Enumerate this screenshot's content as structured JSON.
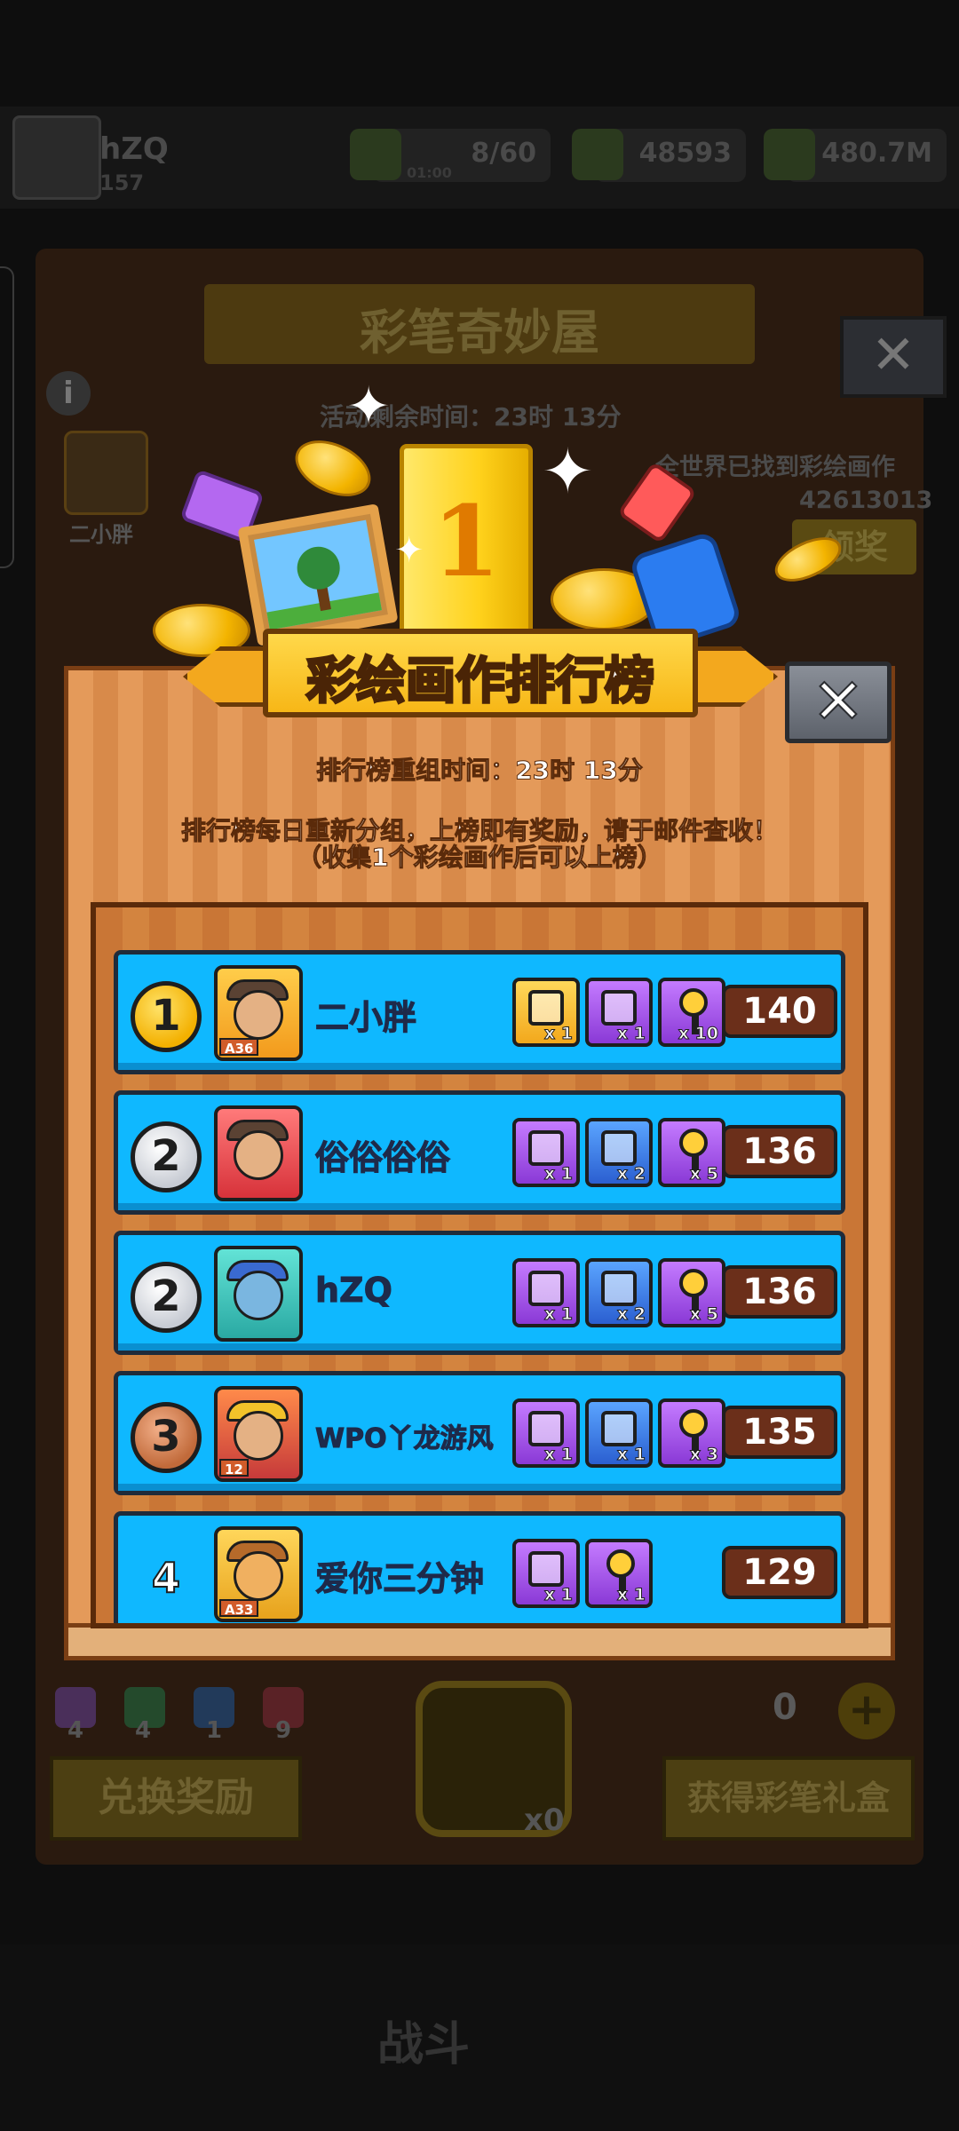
{
  "background": {
    "player_name": "hZQ",
    "player_level": "157",
    "resources": [
      {
        "value": "8/60",
        "sub": "01:00"
      },
      {
        "value": "48593"
      },
      {
        "value": "480.7M"
      }
    ],
    "shop_title": "彩笔奇妙屋",
    "event_time": "活动剩余时间：23时 13分",
    "leader_name": "二小胖",
    "world_text": "全世界已找到彩绘画作",
    "world_count": "42613013",
    "claim_label": "领奖",
    "pencil_counts": [
      "4",
      "4",
      "1",
      "9"
    ],
    "exchange_label": "兑换奖励",
    "unlock_count": "x0",
    "gift_count": "0",
    "get_box_label": "获得彩笔礼盒",
    "battle_label": "战斗",
    "close_glyph": "✕",
    "info_glyph": "i",
    "plus_glyph": "+"
  },
  "header_art": {
    "gold_bar_number": "1"
  },
  "leaderboard": {
    "title": "彩绘画作排行榜",
    "close_glyph": "✕",
    "reset_time": "排行榜重组时间：23时 13分",
    "rules_line1": "排行榜每日重新分组，上榜即有奖励，请于邮件查收！",
    "rules_line2": "（收集1个彩绘画作后可以上榜）",
    "rows": [
      {
        "rank": "1",
        "medal": "gold",
        "name": "二小胖",
        "avatar_tag": "A36",
        "avatar_color": "orange",
        "score": "140",
        "rewards": [
          {
            "type": "gold-chest",
            "qty": "x 1"
          },
          {
            "type": "purple-chest",
            "qty": "x 1"
          },
          {
            "type": "key",
            "qty": "x 10"
          }
        ]
      },
      {
        "rank": "2",
        "medal": "silver",
        "name": "俗俗俗俗",
        "avatar_tag": "",
        "avatar_color": "red",
        "score": "136",
        "rewards": [
          {
            "type": "purple-chest",
            "qty": "x 1"
          },
          {
            "type": "blue-chest",
            "qty": "x 2"
          },
          {
            "type": "key",
            "qty": "x 5"
          }
        ]
      },
      {
        "rank": "2",
        "medal": "silver",
        "name": "hZQ",
        "avatar_tag": "",
        "avatar_color": "teal",
        "score": "136",
        "rewards": [
          {
            "type": "purple-chest",
            "qty": "x 1"
          },
          {
            "type": "blue-chest",
            "qty": "x 2"
          },
          {
            "type": "key",
            "qty": "x 5"
          }
        ]
      },
      {
        "rank": "3",
        "medal": "bronze",
        "name": "WPO丫龙游风",
        "avatar_tag": "12",
        "avatar_color": "maroon",
        "score": "135",
        "rewards": [
          {
            "type": "purple-chest",
            "qty": "x 1"
          },
          {
            "type": "blue-chest",
            "qty": "x 1"
          },
          {
            "type": "key",
            "qty": "x 3"
          }
        ]
      },
      {
        "rank": "4",
        "medal": "none",
        "name": "爱你三分钟",
        "avatar_tag": "A33",
        "avatar_color": "yellow",
        "score": "129",
        "rewards": [
          {
            "type": "purple-chest",
            "qty": "x 1"
          },
          {
            "type": "key",
            "qty": "x 1"
          }
        ]
      }
    ]
  },
  "colors": {
    "row_blue": "#0fb8ff",
    "panel_wood": "#e49a5a",
    "ribbon_gold": "#ffd84a",
    "score_brown": "#6b2f1a"
  }
}
